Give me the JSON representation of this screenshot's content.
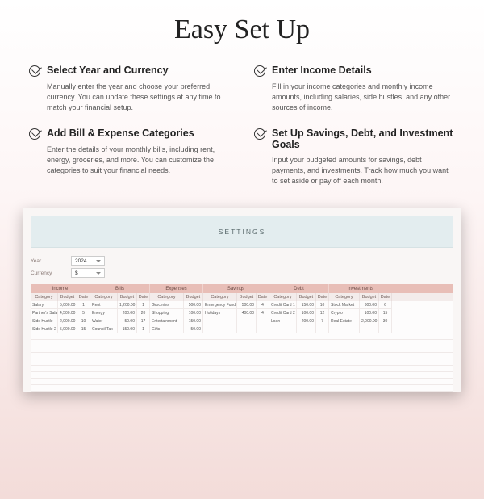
{
  "title": "Easy Set Up",
  "features": [
    {
      "title": "Select Year and Currency",
      "desc": "Manually enter the year and choose your preferred currency. You can update these settings at any time to match your financial setup."
    },
    {
      "title": "Enter Income Details",
      "desc": "Fill in your income categories and monthly income amounts, including salaries, side hustles, and any other sources of income."
    },
    {
      "title": "Add Bill & Expense Categories",
      "desc": "Enter the details of your monthly bills, including rent, energy, groceries, and more. You can customize the categories to suit your financial needs."
    },
    {
      "title": "Set Up Savings, Debt, and Investment Goals",
      "desc": "Input your budgeted amounts for savings, debt payments, and investments. Track how much you want to set aside or pay off each month."
    }
  ],
  "sheet": {
    "settingsLabel": "SETTINGS",
    "yearLabel": "Year",
    "yearValue": "2024",
    "currencyLabel": "Currency",
    "currencyValue": "$",
    "sections": {
      "income": "Income",
      "bills": "Bills",
      "expenses": "Expenses",
      "savings": "Savings",
      "debt": "Debt",
      "investments": "Investments"
    },
    "cols": {
      "category": "Category",
      "budget": "Budget",
      "date": "Date"
    },
    "rows": [
      {
        "income_cat": "Salary",
        "income_bud": "5,000.00",
        "income_date": "1",
        "bills_cat": "Rent",
        "bills_bud": "1,200.00",
        "bills_date": "1",
        "exp_cat": "Groceries",
        "exp_bud": "500.00",
        "sav_cat": "Emergency Fund",
        "sav_bud": "500.00",
        "sav_date": "4",
        "debt_cat": "Credit Card 1",
        "debt_bud": "150.00",
        "debt_date": "10",
        "inv_cat": "Stock Market",
        "inv_bud": "300.00",
        "inv_date": "6"
      },
      {
        "income_cat": "Partner's Salary",
        "income_bud": "4,500.00",
        "income_date": "5",
        "bills_cat": "Energy",
        "bills_bud": "200.00",
        "bills_date": "20",
        "exp_cat": "Shopping",
        "exp_bud": "100.00",
        "sav_cat": "Holidays",
        "sav_bud": "400.00",
        "sav_date": "4",
        "debt_cat": "Credit Card 2",
        "debt_bud": "100.00",
        "debt_date": "12",
        "inv_cat": "Crypto",
        "inv_bud": "100.00",
        "inv_date": "15"
      },
      {
        "income_cat": "Side Hustle",
        "income_bud": "2,000.00",
        "income_date": "10",
        "bills_cat": "Water",
        "bills_bud": "50.00",
        "bills_date": "17",
        "exp_cat": "Entertainment",
        "exp_bud": "150.00",
        "sav_cat": "",
        "sav_bud": "",
        "sav_date": "",
        "debt_cat": "Loan",
        "debt_bud": "200.00",
        "debt_date": "7",
        "inv_cat": "Real Estate",
        "inv_bud": "2,000.00",
        "inv_date": "30"
      },
      {
        "income_cat": "Side Hustle 2",
        "income_bud": "5,000.00",
        "income_date": "15",
        "bills_cat": "Council Tax",
        "bills_bud": "150.00",
        "bills_date": "1",
        "exp_cat": "Gifts",
        "exp_bud": "50.00",
        "sav_cat": "",
        "sav_bud": "",
        "sav_date": "",
        "debt_cat": "",
        "debt_bud": "",
        "debt_date": "",
        "inv_cat": "",
        "inv_bud": "",
        "inv_date": ""
      }
    ]
  }
}
